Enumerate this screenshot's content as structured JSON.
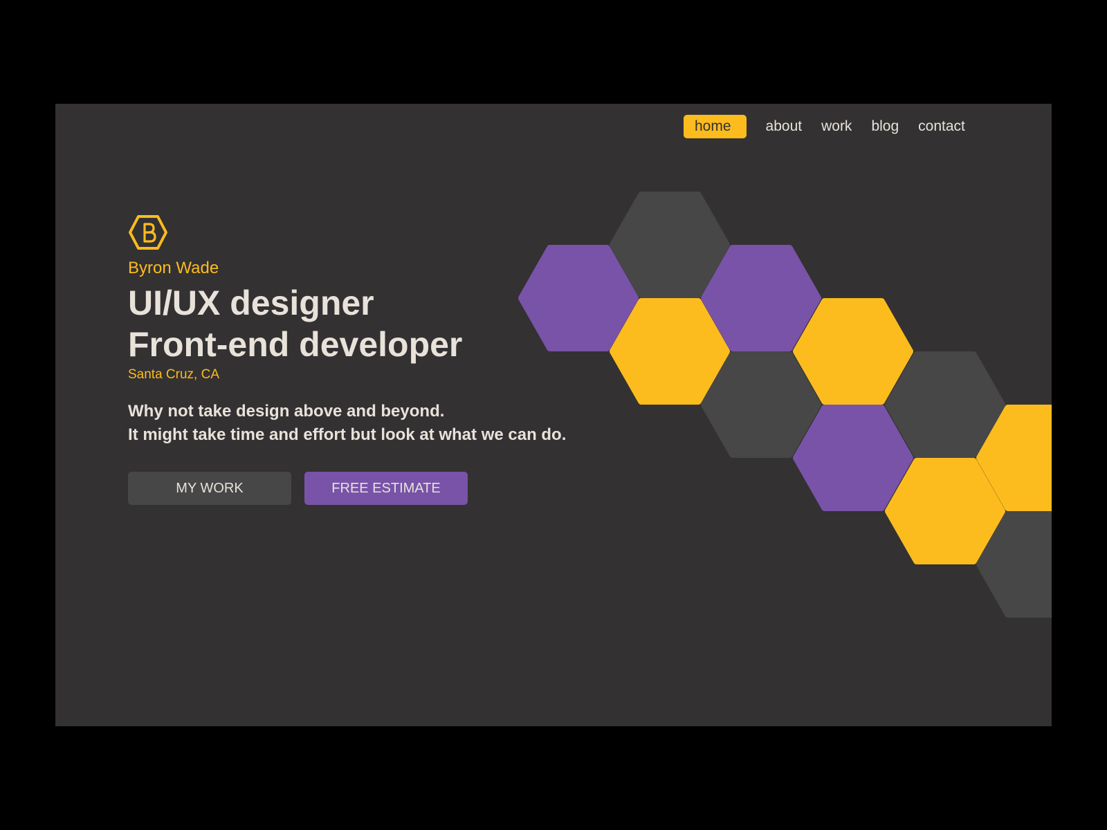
{
  "nav": {
    "items": [
      {
        "label": "home",
        "active": true
      },
      {
        "label": "about",
        "active": false
      },
      {
        "label": "work",
        "active": false
      },
      {
        "label": "blog",
        "active": false
      },
      {
        "label": "contact",
        "active": false
      }
    ]
  },
  "hero": {
    "logo_icon": "hexagon-b-logo-icon",
    "name": "Byron Wade",
    "headline_line1": "UI/UX designer",
    "headline_line2": "Front-end developer",
    "location": "Santa Cruz, CA",
    "tagline_line1": "Why not take design above and beyond.",
    "tagline_line2": "It might take time and effort but look at what we can do."
  },
  "buttons": {
    "my_work": "MY WORK",
    "free_estimate": "FREE ESTIMATE"
  },
  "colors": {
    "background": "#333132",
    "page_backdrop": "#000000",
    "accent_yellow": "#fdbc1e",
    "accent_purple": "#7853a8",
    "neutral_gray": "#474747",
    "text_light": "#e8e2da"
  },
  "honeycomb": {
    "tiles": [
      {
        "color": "gray"
      },
      {
        "color": "purple"
      },
      {
        "color": "yellow"
      },
      {
        "color": "purple"
      },
      {
        "color": "gray"
      },
      {
        "color": "yellow"
      },
      {
        "color": "purple"
      },
      {
        "color": "gray"
      },
      {
        "color": "yellow"
      },
      {
        "color": "yellow"
      },
      {
        "color": "gray"
      }
    ]
  }
}
